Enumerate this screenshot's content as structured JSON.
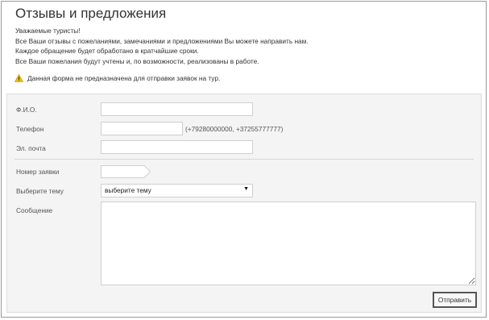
{
  "page": {
    "title": "Отзывы и предложения"
  },
  "intro": {
    "lines": [
      "Уважаемые туристы!",
      "Все Ваши отзывы с пожеланиями, замечаниями и предложениями Вы можете направить нам.",
      "Каждое обращение будет обработано в кратчайшие сроки.",
      "Все Ваши пожелания будут учтены и, по возможности, реализованы в работе."
    ]
  },
  "warning": {
    "icon": "warning-triangle-icon",
    "text": "Данная форма не предназначена для отправки заявок на тур.",
    "icon_color": "#e8b200"
  },
  "form": {
    "fio_label": "Ф.И.О.",
    "fio_value": "",
    "phone_label": "Телефон",
    "phone_value": "",
    "phone_hint": "(+79280000000, +37255777777)",
    "email_label": "Эл. почта",
    "email_value": "",
    "order_label": "Номер заявки",
    "order_value": "",
    "topic_label": "Выберите тему",
    "topic_selected": "выберите тему",
    "message_label": "Сообщение",
    "message_value": "",
    "submit_label": "Отправить"
  }
}
